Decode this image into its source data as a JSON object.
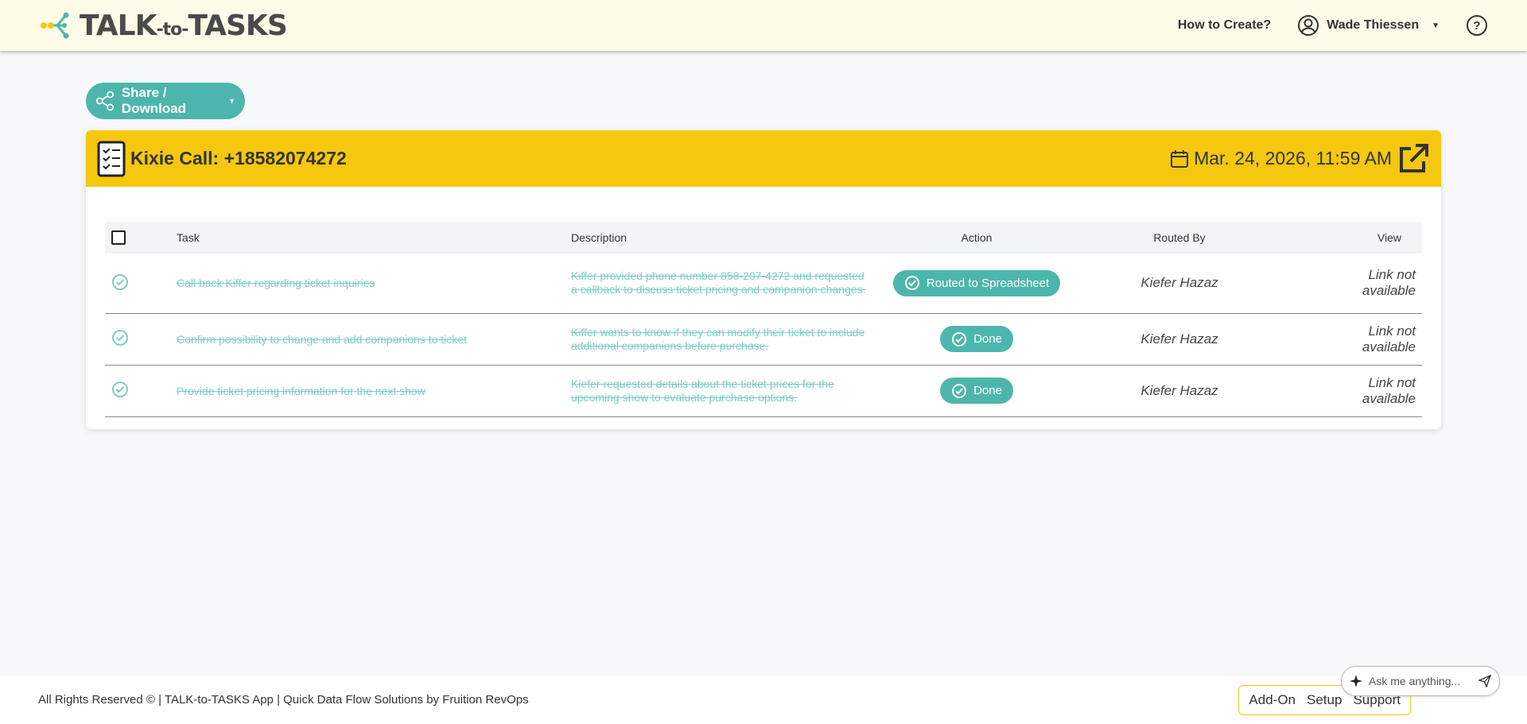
{
  "header": {
    "logo_main": "TALK",
    "logo_small": "-to-",
    "logo_tail": "TASKS",
    "how_to": "How to Create?",
    "user_name": "Wade Thiessen",
    "help": "?"
  },
  "share_button": "Share / Download",
  "card": {
    "title": "Kixie Call: +18582074272",
    "date": "Mar. 24, 2026, 11:59 AM"
  },
  "table": {
    "headers": [
      "Task",
      "Description",
      "Action",
      "Routed By",
      "View"
    ],
    "rows": [
      {
        "task": "Call back Kiffer regarding ticket inquiries",
        "description": "Kiffer provided phone number 858-207-4272 and requested a callback to discuss ticket pricing and companion changes.",
        "action": "Routed to Spreadsheet",
        "routed_by": "Kiefer Hazaz",
        "view_1": "Link not",
        "view_2": "available"
      },
      {
        "task": "Confirm possibility to change and add companions to ticket",
        "description": "Kiffer wants to know if they can modify their ticket to include additional companions before purchase.",
        "action": "Done",
        "routed_by": "Kiefer Hazaz",
        "view_1": "Link not",
        "view_2": "available"
      },
      {
        "task": "Provide ticket pricing information for the next show",
        "description": "Kiefer requested details about the ticket prices for the upcoming show to evaluate purchase options.",
        "action": "Done",
        "routed_by": "Kiefer Hazaz",
        "view_1": "Link not",
        "view_2": "available"
      }
    ]
  },
  "footer": {
    "text": "All Rights Reserved © | TALK-to-TASKS App | Quick Data Flow Solutions by Fruition RevOps",
    "links": [
      "Add-On",
      "Setup",
      "Support"
    ]
  },
  "ask": {
    "placeholder": "Ask me anything..."
  },
  "colors": {
    "header_bg": "#fefce8",
    "accent_teal": "#4db6ac",
    "card_header_yellow": "#f5c70f",
    "struck_text": "#7fcdc5"
  }
}
